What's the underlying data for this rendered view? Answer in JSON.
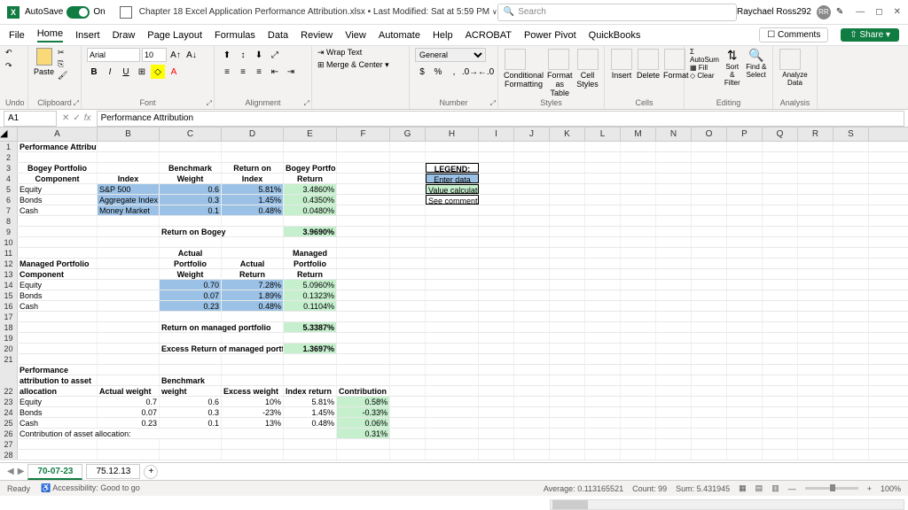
{
  "titlebar": {
    "autosave": "AutoSave",
    "on": "On",
    "doc": "Chapter 18 Excel Application Performance Attribution.xlsx • Last Modified: Sat at 5:59 PM",
    "search": "Search",
    "user": "Raychael Ross292",
    "initials": "RR"
  },
  "menu": {
    "file": "File",
    "home": "Home",
    "insert": "Insert",
    "draw": "Draw",
    "page": "Page Layout",
    "formulas": "Formulas",
    "data": "Data",
    "review": "Review",
    "view": "View",
    "automate": "Automate",
    "help": "Help",
    "acrobat": "ACROBAT",
    "powerpivot": "Power Pivot",
    "quickbooks": "QuickBooks",
    "comments": "Comments",
    "share": "Share"
  },
  "ribbon": {
    "undo": "Undo",
    "clipboard": "Clipboard",
    "paste": "Paste",
    "font": "Font",
    "fontname": "Arial",
    "fontsize": "10",
    "alignment": "Alignment",
    "wrap": "Wrap Text",
    "merge": "Merge & Center",
    "number": "Number",
    "general": "General",
    "styles": "Styles",
    "cond": "Conditional Formatting",
    "fmtas": "Format as Table",
    "cellst": "Cell Styles",
    "cells": "Cells",
    "insert": "Insert",
    "delete": "Delete",
    "format": "Format",
    "editing": "Editing",
    "autosum": "AutoSum",
    "fill": "Fill",
    "clear": "Clear",
    "sort": "Sort & Filter",
    "find": "Find & Select",
    "analysis": "Analysis",
    "analyze": "Analyze Data"
  },
  "namebox": "A1",
  "formula": "Performance Attribution",
  "cols": [
    "A",
    "B",
    "C",
    "D",
    "E",
    "F",
    "G",
    "H",
    "I",
    "J",
    "K",
    "L",
    "M",
    "N",
    "O",
    "P",
    "Q",
    "R",
    "S"
  ],
  "r": {
    "1": {
      "A": "Performance Attribution"
    },
    "3": {
      "A": "Bogey Portfolio",
      "C": "Benchmark",
      "D": "Return on",
      "E": "Bogey Portfolio",
      "H": "LEGEND:"
    },
    "4": {
      "A": "Component",
      "B": "Index",
      "C": "Weight",
      "D": "Index",
      "E": "Return",
      "H": "Enter data"
    },
    "5": {
      "A": "Equity",
      "B": "S&P 500",
      "C": "0.6",
      "D": "5.81%",
      "E": "3.4860%",
      "H": "Value calculated"
    },
    "6": {
      "A": "Bonds",
      "B": "Aggregate Index",
      "C": "0.3",
      "D": "1.45%",
      "E": "0.4350%",
      "H": "See comment"
    },
    "7": {
      "A": "Cash",
      "B": "Money Market",
      "C": "0.1",
      "D": "0.48%",
      "E": "0.0480%"
    },
    "9": {
      "D": "Return on Bogey",
      "E": "3.9690%"
    },
    "11": {
      "C": "Actual",
      "E": "Managed"
    },
    "12": {
      "A": "Managed Portfolio",
      "C": "Portfolio",
      "D": "Actual",
      "E": "Portfolio"
    },
    "13": {
      "A": "Component",
      "C": "Weight",
      "D": "Return",
      "E": "Return"
    },
    "14": {
      "A": "Equity",
      "C": "0.70",
      "D": "7.28%",
      "E": "5.0960%"
    },
    "15": {
      "A": "Bonds",
      "C": "0.07",
      "D": "1.89%",
      "E": "0.1323%"
    },
    "16": {
      "A": "Cash",
      "C": "0.23",
      "D": "0.48%",
      "E": "0.1104%"
    },
    "18": {
      "D": "Return on managed portfolio",
      "E": "5.3387%"
    },
    "20": {
      "D": "Excess Return of managed portf",
      "E": "1.3697%"
    },
    "22a": {
      "A": "Performance"
    },
    "22b": {
      "A": "attribution to asset",
      "C": "Benchmark"
    },
    "22": {
      "A": "allocation",
      "B": "Actual weight",
      "C": "weight",
      "D": "Excess weight",
      "E": "Index return",
      "F": "Contribution"
    },
    "23": {
      "A": "Equity",
      "B": "0.7",
      "C": "0.6",
      "D": "10%",
      "E": "5.81%",
      "F": "0.58%"
    },
    "24": {
      "A": "Bonds",
      "B": "0.07",
      "C": "0.3",
      "D": "-23%",
      "E": "1.45%",
      "F": "-0.33%"
    },
    "25": {
      "A": "Cash",
      "B": "0.23",
      "C": "0.1",
      "D": "13%",
      "E": "0.48%",
      "F": "0.06%"
    },
    "26": {
      "A": "Contribution of asset allocation:",
      "F": "0.31%"
    }
  },
  "tabs": {
    "t1": "70-07-23",
    "t2": "75.12.13"
  },
  "status": {
    "ready": "Ready",
    "access": "Accessibility: Good to go",
    "avg": "Average: 0.113165521",
    "count": "Count: 99",
    "sum": "Sum: 5.431945",
    "zoom": "100%"
  },
  "chart_data": null
}
